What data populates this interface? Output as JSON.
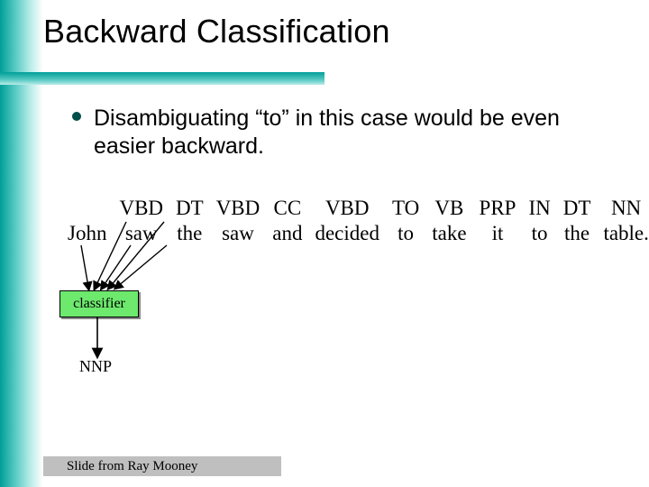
{
  "title": "Backward Classification",
  "bullet": "Disambiguating “to” in this case would be even easier backward.",
  "table": {
    "tags": [
      "",
      "VBD",
      "DT",
      "VBD",
      "CC",
      "VBD",
      "TO",
      "VB",
      "PRP",
      "IN",
      "DT",
      "NN"
    ],
    "words": [
      "John",
      "saw",
      "the",
      "saw",
      "and",
      "decided",
      "to",
      "take",
      "it",
      "to",
      "the",
      "table."
    ]
  },
  "classifier_label": "classifier",
  "output_tag": "NNP",
  "footer": "Slide from Ray Mooney"
}
